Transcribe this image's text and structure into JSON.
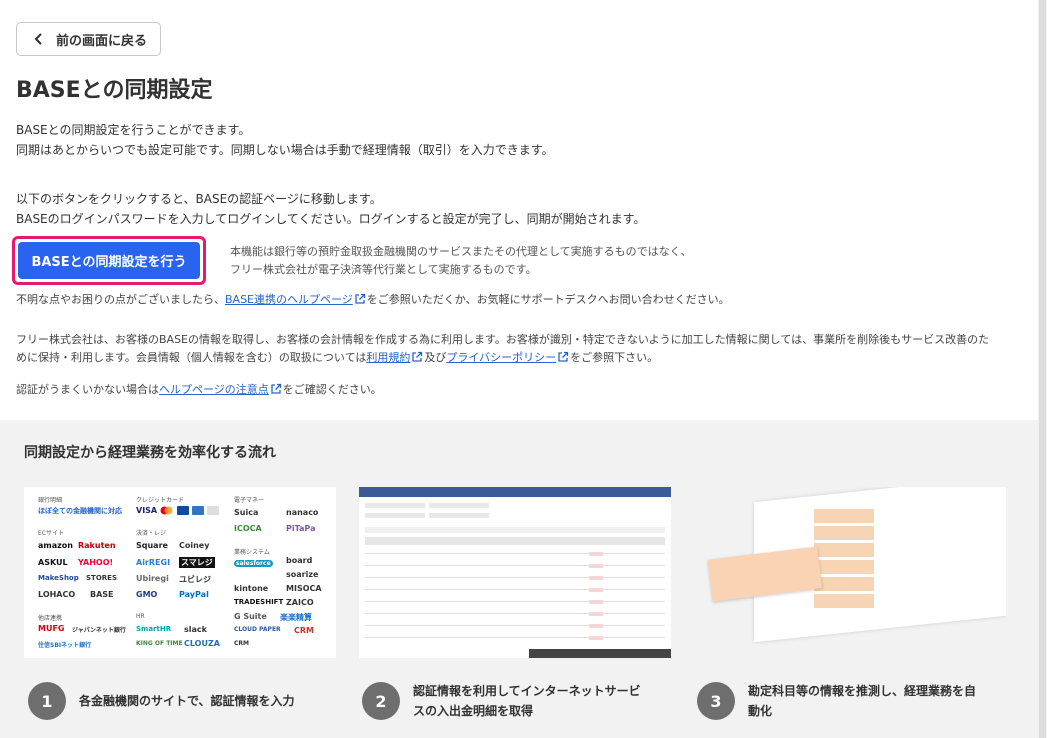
{
  "back_button": {
    "label": "前の画面に戻る",
    "icon": "chevron-left-icon"
  },
  "page_title": "BASEとの同期設定",
  "intro": {
    "line1": "BASEとの同期設定を行うことができます。",
    "line2": "同期はあとからいつでも設定可能です。同期しない場合は手動で経理情報（取引）を入力できます。"
  },
  "instructions": {
    "line1": "以下のボタンをクリックすると、BASEの認証ページに移動します。",
    "line2": "BASEのログインパスワードを入力してログインしてください。ログインすると設定が完了し、同期が開始されます。"
  },
  "cta_button": "BASEとの同期設定を行う",
  "disclaimer": {
    "line1": "本機能は銀行等の預貯金取扱金融機関のサービスまたその代理として実施するものではなく、",
    "line2": "フリー株式会社が電子決済等代行業として実施するものです。"
  },
  "help_note": {
    "before": "不明な点やお困りの点がございましたら、",
    "link": "BASE連携のヘルプページ",
    "after": "をご参照いただくか、お気軽にサポートデスクへお問い合わせください。"
  },
  "privacy_note": {
    "line1": "フリー株式会社は、お客様のBASEの情報を取得し、お客様の会計情報を作成する為に利用します。お客様が識別・特定できないように加工した情報に関しては、事業所を削除後もサービス改善のた",
    "line2_before": "めに保持・利用します。会員情報（個人情報を含む）の取扱については",
    "terms_link": "利用規約",
    "middle": "及び",
    "privacy_link": "プライバシーポリシー",
    "line2_after": "をご参照下さい。"
  },
  "auth_note": {
    "before": "認証がうまくいかない場合は",
    "link": "ヘルプページの注意点",
    "after": "をご確認ください。"
  },
  "flow_section": {
    "title": "同期設定から経理業務を効率化する流れ",
    "steps": [
      {
        "number": "1",
        "text_line1": "各金融機関のサイトで、認証情報を入力",
        "text_line2": ""
      },
      {
        "number": "2",
        "text_line1": "認証情報を利用してインターネットサービ",
        "text_line2": "スの入出金明細を取得"
      },
      {
        "number": "3",
        "text_line1": "勘定科目等の情報を推測し、経理業務を自",
        "text_line2": "動化"
      }
    ]
  },
  "logo_panel": {
    "categories": {
      "bank": "銀行明細",
      "bank_sub": "ほぼ全ての金融機関に対応",
      "credit": "クレジットカード",
      "emoney": "電子マネー",
      "ec": "ECサイト",
      "payment": "決済・レジ",
      "business": "業務システム",
      "securities": "他店連携",
      "hr": "HR"
    },
    "logos": [
      "VISA",
      "amazon",
      "Rakuten",
      "ASKUL",
      "YAHOO!",
      "MakeShop",
      "STORES",
      "LOHACO",
      "BASE",
      "Square",
      "Coiney",
      "AirREGI",
      "スマレジ",
      "Ubiregi",
      "ユビレジ",
      "GMO",
      "PayPal",
      "Suica",
      "nanaco",
      "ICOCA",
      "PiTaPa",
      "salesforce",
      "board",
      "soarize",
      "kintone",
      "MISOCA",
      "TRADESHIFT",
      "ZAICO",
      "G Suite",
      "楽楽精算",
      "CLOUD PAPER",
      "CRM",
      "MUFG",
      "ジャパンネット銀行",
      "住信SBIネット銀行",
      "SmartHR",
      "slack",
      "KING OF TIME",
      "CLOUZA",
      "CRM"
    ]
  },
  "colors": {
    "cta": "#2864f0",
    "cta_highlight": "#e6196e",
    "link": "#2864c8",
    "step_circle": "#6e6e6e",
    "section_bg": "#f2f2f2"
  }
}
